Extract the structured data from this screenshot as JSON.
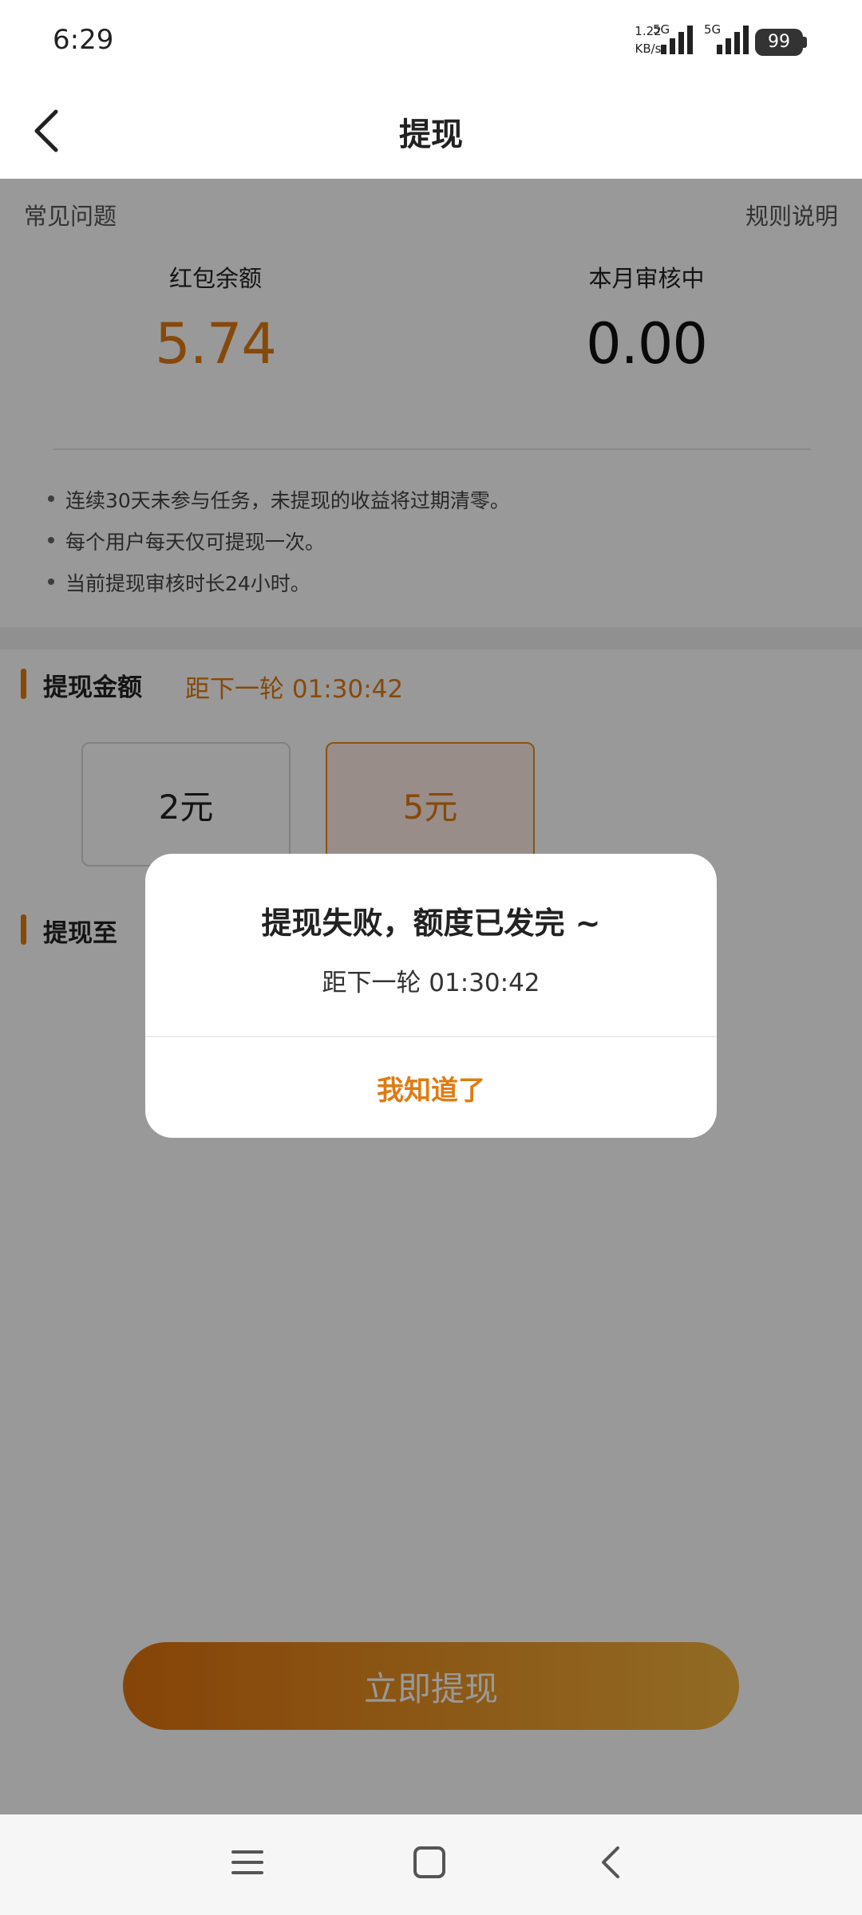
{
  "status_bar": {
    "time": "6:29",
    "net_speed_value": "1.22",
    "net_speed_unit": "KB/s",
    "net_type_1": "5G",
    "net_type_2": "5G",
    "battery": "99"
  },
  "nav": {
    "title": "提现"
  },
  "summary": {
    "faq_label": "常见问题",
    "rules_label": "规则说明",
    "balance_label": "红包余额",
    "balance_value": "5.74",
    "review_label": "本月审核中",
    "review_value": "0.00",
    "notes": [
      "连续30天未参与任务，未提现的收益将过期清零。",
      "每个用户每天仅可提现一次。",
      "当前提现审核时长24小时。"
    ]
  },
  "amount_section": {
    "title": "提现金额",
    "countdown": "距下一轮 01:30:42",
    "options": [
      "2元",
      "5元"
    ],
    "selected_index": 1
  },
  "target_section": {
    "title": "提现至"
  },
  "withdraw_button": {
    "label": "立即提现"
  },
  "dialog": {
    "title": "提现失败，额度已发完 ~",
    "subtitle": "距下一轮 01:30:42",
    "ok_label": "我知道了"
  },
  "colors": {
    "accent": "#e07b12",
    "overlay": "rgba(0,0,0,0.40)"
  }
}
